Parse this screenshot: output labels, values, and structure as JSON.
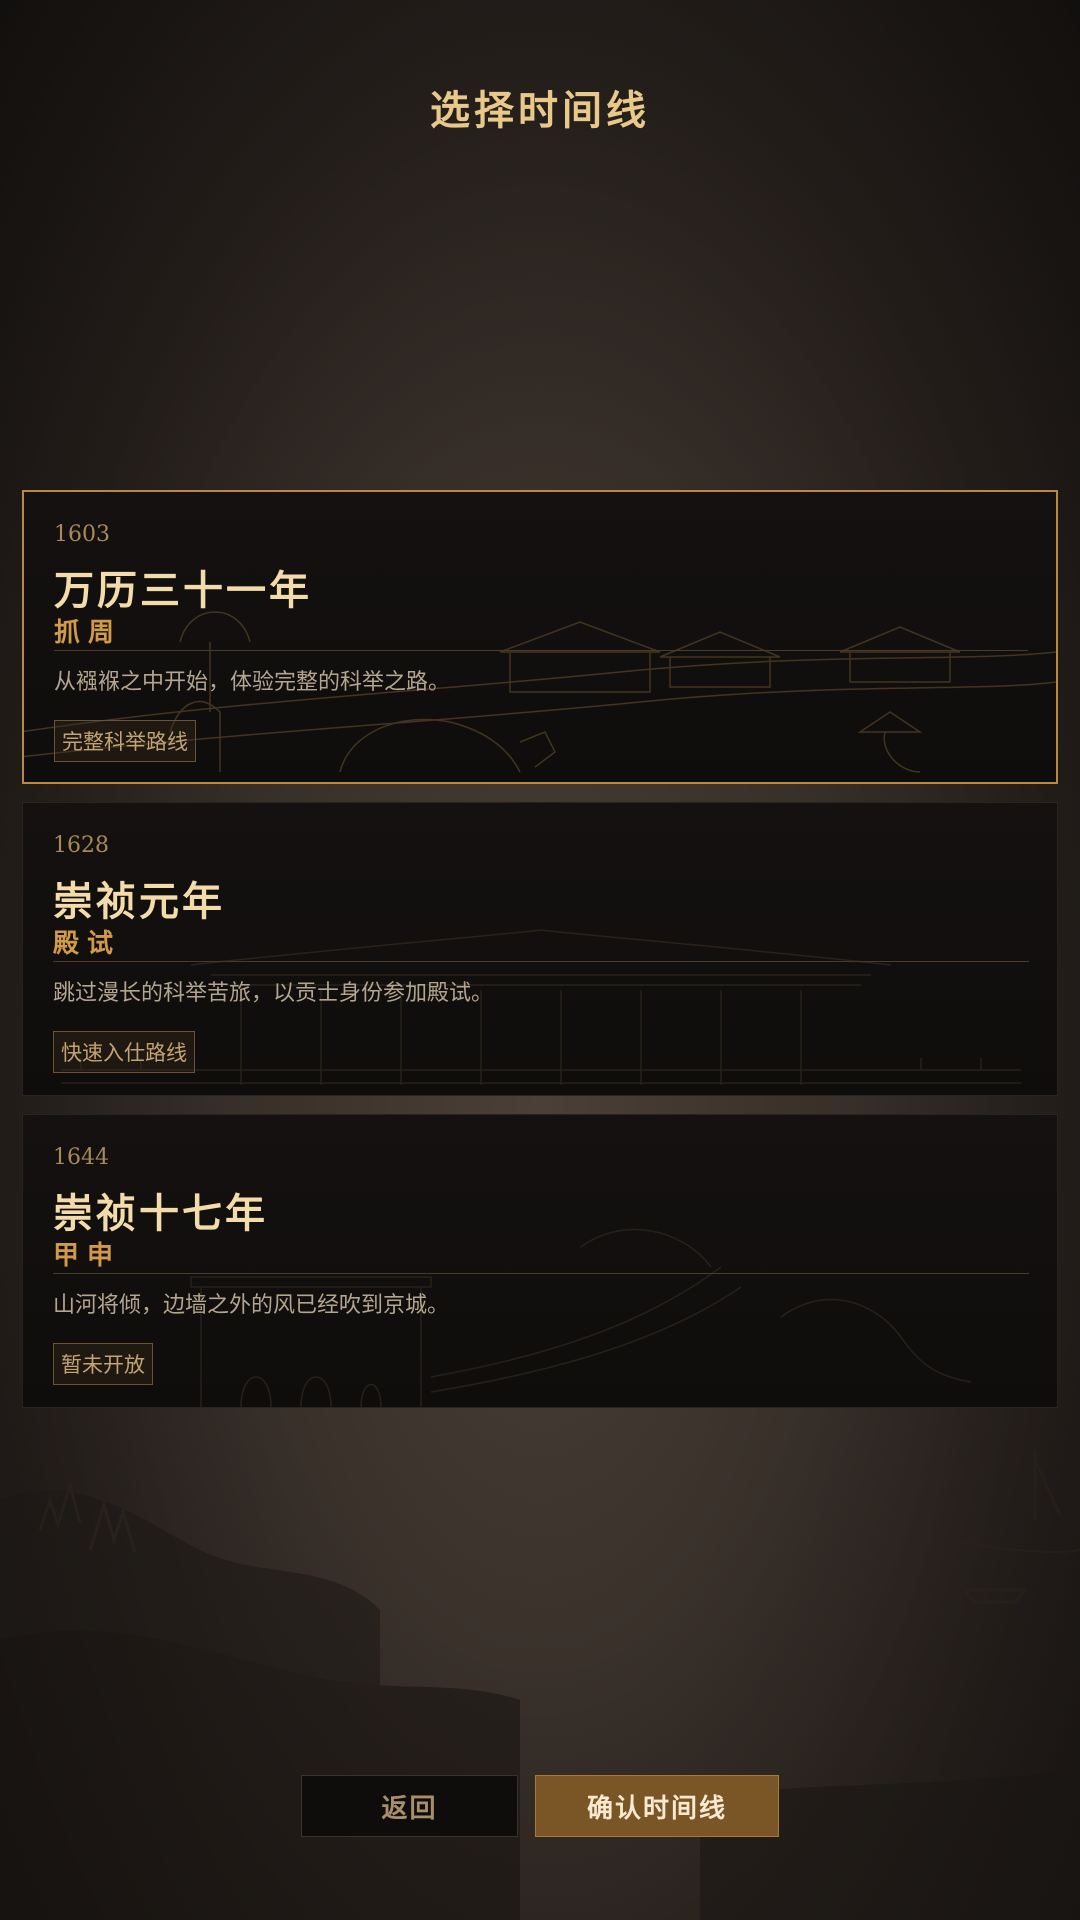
{
  "page": {
    "title": "选择时间线"
  },
  "timelines": [
    {
      "year": "1603",
      "name": "万历三十一年",
      "subtitle": "抓周",
      "description": "从襁褓之中开始，体验完整的科举之路。",
      "tag": "完整科举路线",
      "selected": true,
      "art": "farmland-ox-illustration"
    },
    {
      "year": "1628",
      "name": "崇祯元年",
      "subtitle": "殿试",
      "description": "跳过漫长的科举苦旅，以贡士身份参加殿试。",
      "tag": "快速入仕路线",
      "selected": false,
      "art": "palace-hall-illustration"
    },
    {
      "year": "1644",
      "name": "崇祯十七年",
      "subtitle": "甲申",
      "description": "山河将倾，边墙之外的风已经吹到京城。",
      "tag": "暂未开放",
      "selected": false,
      "art": "great-wall-illustration"
    }
  ],
  "buttons": {
    "back": "返回",
    "confirm": "确认时间线"
  },
  "colors": {
    "accent": "#d19a48",
    "title": "#e9c98a",
    "selected_border": "#b8893e",
    "confirm_bg": "#7a5526"
  }
}
